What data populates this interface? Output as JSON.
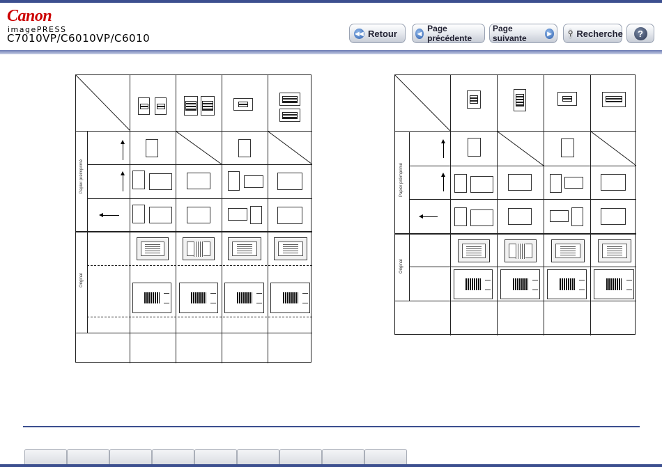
{
  "header": {
    "brand": "Canon",
    "product_line": "imagePRESS",
    "model": "C7010VP/C6010VP/C6010"
  },
  "nav": {
    "back": {
      "label": "Retour",
      "icon": "rewind-icon"
    },
    "prev": {
      "label": "Page précédente",
      "icon": "arrow-left-icon"
    },
    "next": {
      "label": "Page suivante",
      "icon": "arrow-right-icon"
    },
    "search": {
      "label": "Recherche",
      "icon": "search-icon"
    },
    "help": {
      "icon": "help-icon",
      "glyph": "?"
    }
  },
  "tables": {
    "left": {
      "paper_label": "Papier préimprimé",
      "original_label": "Original"
    },
    "right": {
      "paper_label": "Papier préimprimé",
      "original_label": "Original"
    }
  },
  "footer": {
    "tab_count": 9
  },
  "colors": {
    "brand": "#cc0000",
    "accent": "#3c4f8f"
  }
}
